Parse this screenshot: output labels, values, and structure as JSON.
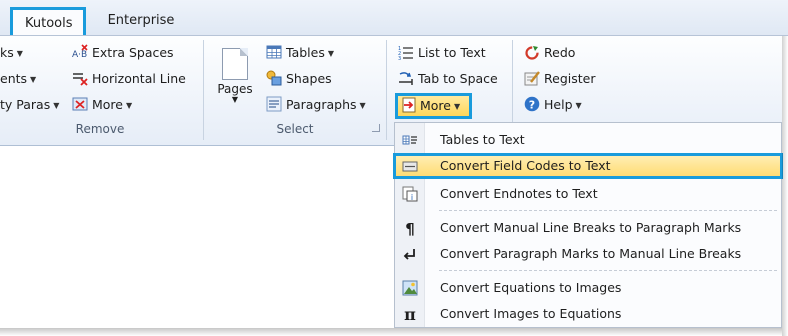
{
  "tabs": [
    {
      "label": "Kutools"
    },
    {
      "label": "Enterprise"
    }
  ],
  "ribbon": {
    "remove_group": {
      "label": "Remove",
      "items": [
        {
          "label": "ks",
          "has_caret": true
        },
        {
          "label": "ents",
          "has_caret": true
        },
        {
          "label": "ty Paras",
          "has_caret": true
        },
        {
          "label": "Extra Spaces"
        },
        {
          "label": "Horizontal Line"
        },
        {
          "label": "More",
          "has_caret": true
        }
      ]
    },
    "select_group": {
      "label": "Select",
      "pages_label": "Pages",
      "items": [
        {
          "label": "Tables",
          "has_caret": true
        },
        {
          "label": "Shapes"
        },
        {
          "label": "Paragraphs",
          "has_caret": true
        }
      ]
    },
    "convert_group": {
      "items": [
        {
          "label": "List to Text"
        },
        {
          "label": "Tab to Space"
        },
        {
          "label": "More",
          "has_caret": true
        }
      ]
    },
    "misc_group": {
      "items": [
        {
          "label": "Redo"
        },
        {
          "label": "Register"
        },
        {
          "label": "Help",
          "has_caret": true
        }
      ]
    }
  },
  "more_menu": {
    "items": [
      {
        "label": "Tables to Text",
        "icon": "table-to-text-icon"
      },
      {
        "label": "Convert Field Codes to Text",
        "icon": "field-code-icon",
        "highlighted": true
      },
      {
        "label": "Convert Endnotes to Text",
        "icon": "endnote-icon"
      },
      {
        "label": "Convert Manual Line Breaks to Paragraph Marks",
        "icon": "pilcrow-icon"
      },
      {
        "label": "Convert Paragraph Marks to Manual Line Breaks",
        "icon": "line-break-icon"
      },
      {
        "label": "Convert Equations to Images",
        "icon": "image-icon"
      },
      {
        "label": "Convert Images to Equations",
        "icon": "pi-icon"
      }
    ]
  },
  "colors": {
    "highlight_border": "#199bdc",
    "menu_highlight": "#ffdc74",
    "ribbon_bg": "#e6edf7"
  }
}
